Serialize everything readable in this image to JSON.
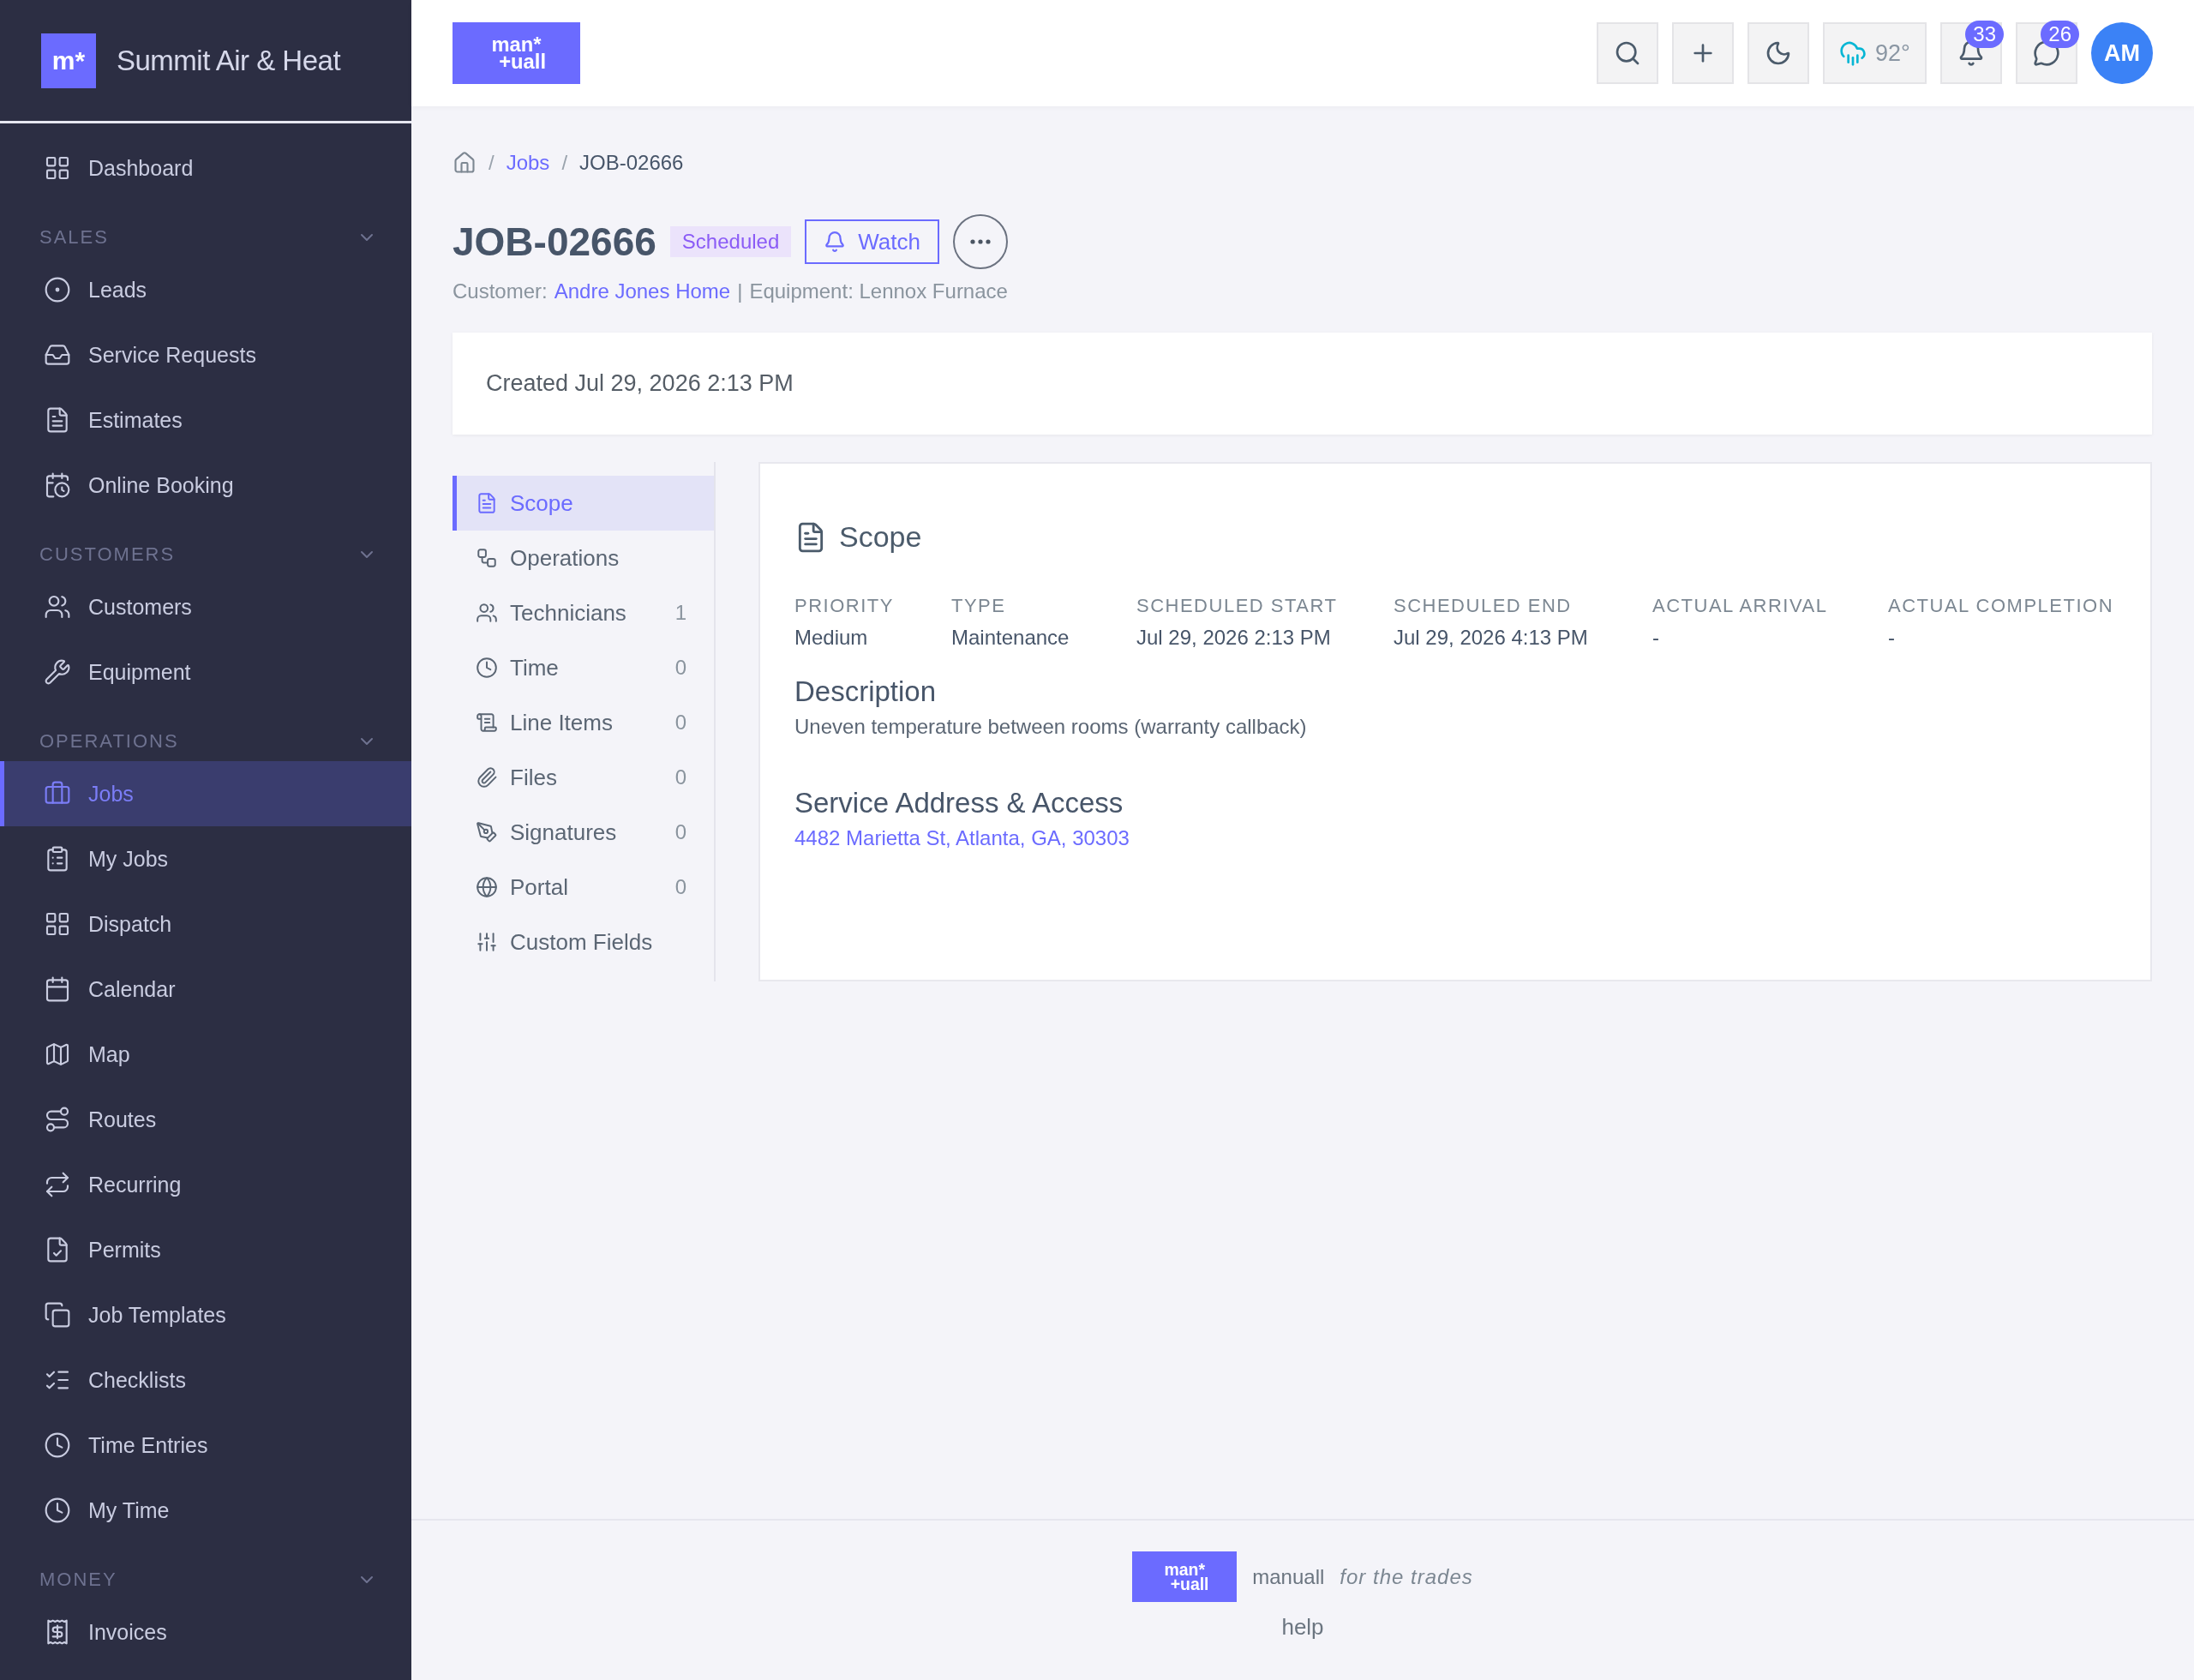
{
  "sidebar": {
    "brand": {
      "mark": "m*",
      "name": "Summit Air & Heat"
    },
    "nav": [
      {
        "kind": "item",
        "label": "Dashboard",
        "selected": false
      },
      {
        "kind": "section",
        "label": "SALES",
        "expanded": true
      },
      {
        "kind": "item",
        "label": "Leads",
        "selected": false
      },
      {
        "kind": "item",
        "label": "Service Requests",
        "selected": false
      },
      {
        "kind": "item",
        "label": "Estimates",
        "selected": false
      },
      {
        "kind": "item",
        "label": "Online Booking",
        "selected": false
      },
      {
        "kind": "section",
        "label": "CUSTOMERS",
        "expanded": true
      },
      {
        "kind": "item",
        "label": "Customers",
        "selected": false
      },
      {
        "kind": "item",
        "label": "Equipment",
        "selected": false
      },
      {
        "kind": "section",
        "label": "OPERATIONS",
        "expanded": true
      },
      {
        "kind": "item",
        "label": "Jobs",
        "selected": true
      },
      {
        "kind": "item",
        "label": "My Jobs",
        "selected": false
      },
      {
        "kind": "item",
        "label": "Dispatch",
        "selected": false
      },
      {
        "kind": "item",
        "label": "Calendar",
        "selected": false
      },
      {
        "kind": "item",
        "label": "Map",
        "selected": false
      },
      {
        "kind": "item",
        "label": "Routes",
        "selected": false
      },
      {
        "kind": "item",
        "label": "Recurring",
        "selected": false
      },
      {
        "kind": "item",
        "label": "Permits",
        "selected": false
      },
      {
        "kind": "item",
        "label": "Job Templates",
        "selected": false
      },
      {
        "kind": "item",
        "label": "Checklists",
        "selected": false
      },
      {
        "kind": "item",
        "label": "Time Entries",
        "selected": false
      },
      {
        "kind": "item",
        "label": "My Time",
        "selected": false
      },
      {
        "kind": "section",
        "label": "MONEY",
        "expanded": true
      },
      {
        "kind": "item",
        "label": "Invoices",
        "selected": false
      }
    ]
  },
  "topbar": {
    "logo": [
      "man*",
      "+uall"
    ],
    "weather": "92°",
    "notifications": "33",
    "messages": "26",
    "avatar": "AM"
  },
  "breadcrumb": {
    "separator": "/",
    "parent": "Jobs",
    "current": "JOB-02666"
  },
  "job": {
    "title": "JOB-02666",
    "status": "Scheduled",
    "watch": "Watch",
    "customer_label": "Customer:",
    "customer": "Andre Jones Home",
    "separator": "|",
    "equipment": "Equipment: Lennox Furnace"
  },
  "created": "Created Jul 29, 2026 2:13 PM",
  "tabs": [
    {
      "label": "Scope",
      "selected": true
    },
    {
      "label": "Operations",
      "selected": false
    },
    {
      "label": "Technicians",
      "count": "1",
      "selected": false
    },
    {
      "label": "Time",
      "count": "0",
      "selected": false
    },
    {
      "label": "Line Items",
      "count": "0",
      "selected": false
    },
    {
      "label": "Files",
      "count": "0",
      "selected": false
    },
    {
      "label": "Signatures",
      "count": "0",
      "selected": false
    },
    {
      "label": "Portal",
      "count": "0",
      "selected": false
    },
    {
      "label": "Custom Fields",
      "selected": false
    }
  ],
  "scope": {
    "title": "Scope",
    "fields": [
      {
        "label": "PRIORITY",
        "value": "Medium"
      },
      {
        "label": "TYPE",
        "value": "Maintenance"
      },
      {
        "label": "SCHEDULED START",
        "value": "Jul 29, 2026 2:13 PM"
      },
      {
        "label": "SCHEDULED END",
        "value": "Jul 29, 2026 4:13 PM"
      },
      {
        "label": "ACTUAL ARRIVAL",
        "value": "-"
      },
      {
        "label": "ACTUAL COMPLETION",
        "value": "-"
      }
    ],
    "description_title": "Description",
    "description": "Uneven temperature between rooms (warranty callback)",
    "address_title": "Service Address & Access",
    "address": "4482 Marietta St, Atlanta, GA, 30303"
  },
  "footer": {
    "logo": [
      "man*",
      "+uall"
    ],
    "name": "manuall",
    "tagline": "for the trades",
    "help": "help"
  }
}
